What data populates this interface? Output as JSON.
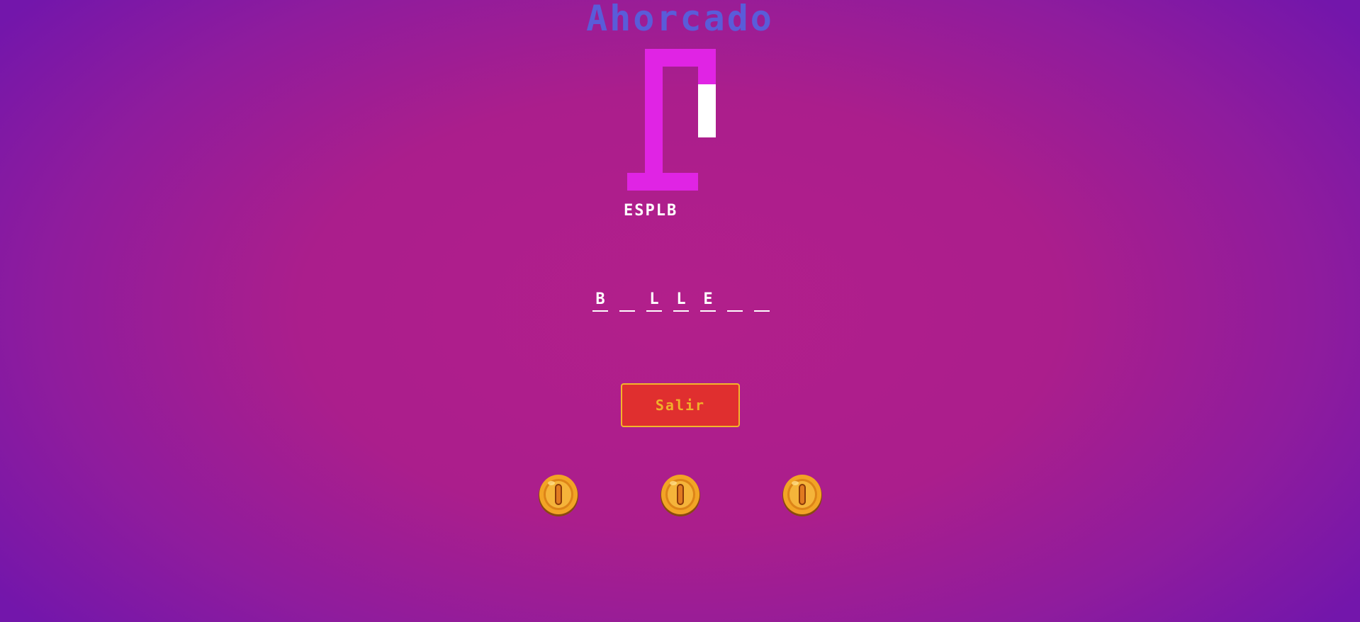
{
  "game": {
    "title": "Ahorcado",
    "used_letters": "ESPLB",
    "word_slots": [
      "B",
      "",
      "L",
      "L",
      "E",
      "",
      ""
    ],
    "exit_label": "Salir"
  },
  "coins": [
    {
      "icon": "coin-icon"
    },
    {
      "icon": "coin-icon"
    },
    {
      "icon": "coin-icon"
    }
  ],
  "colors": {
    "title": "#5a5cd9",
    "gallows": "#e024e4",
    "rope": "#ffffff",
    "button_bg": "#e02f2f",
    "button_border": "#f3b52a",
    "button_text": "#f0b02a",
    "coin": "#f0a020"
  }
}
